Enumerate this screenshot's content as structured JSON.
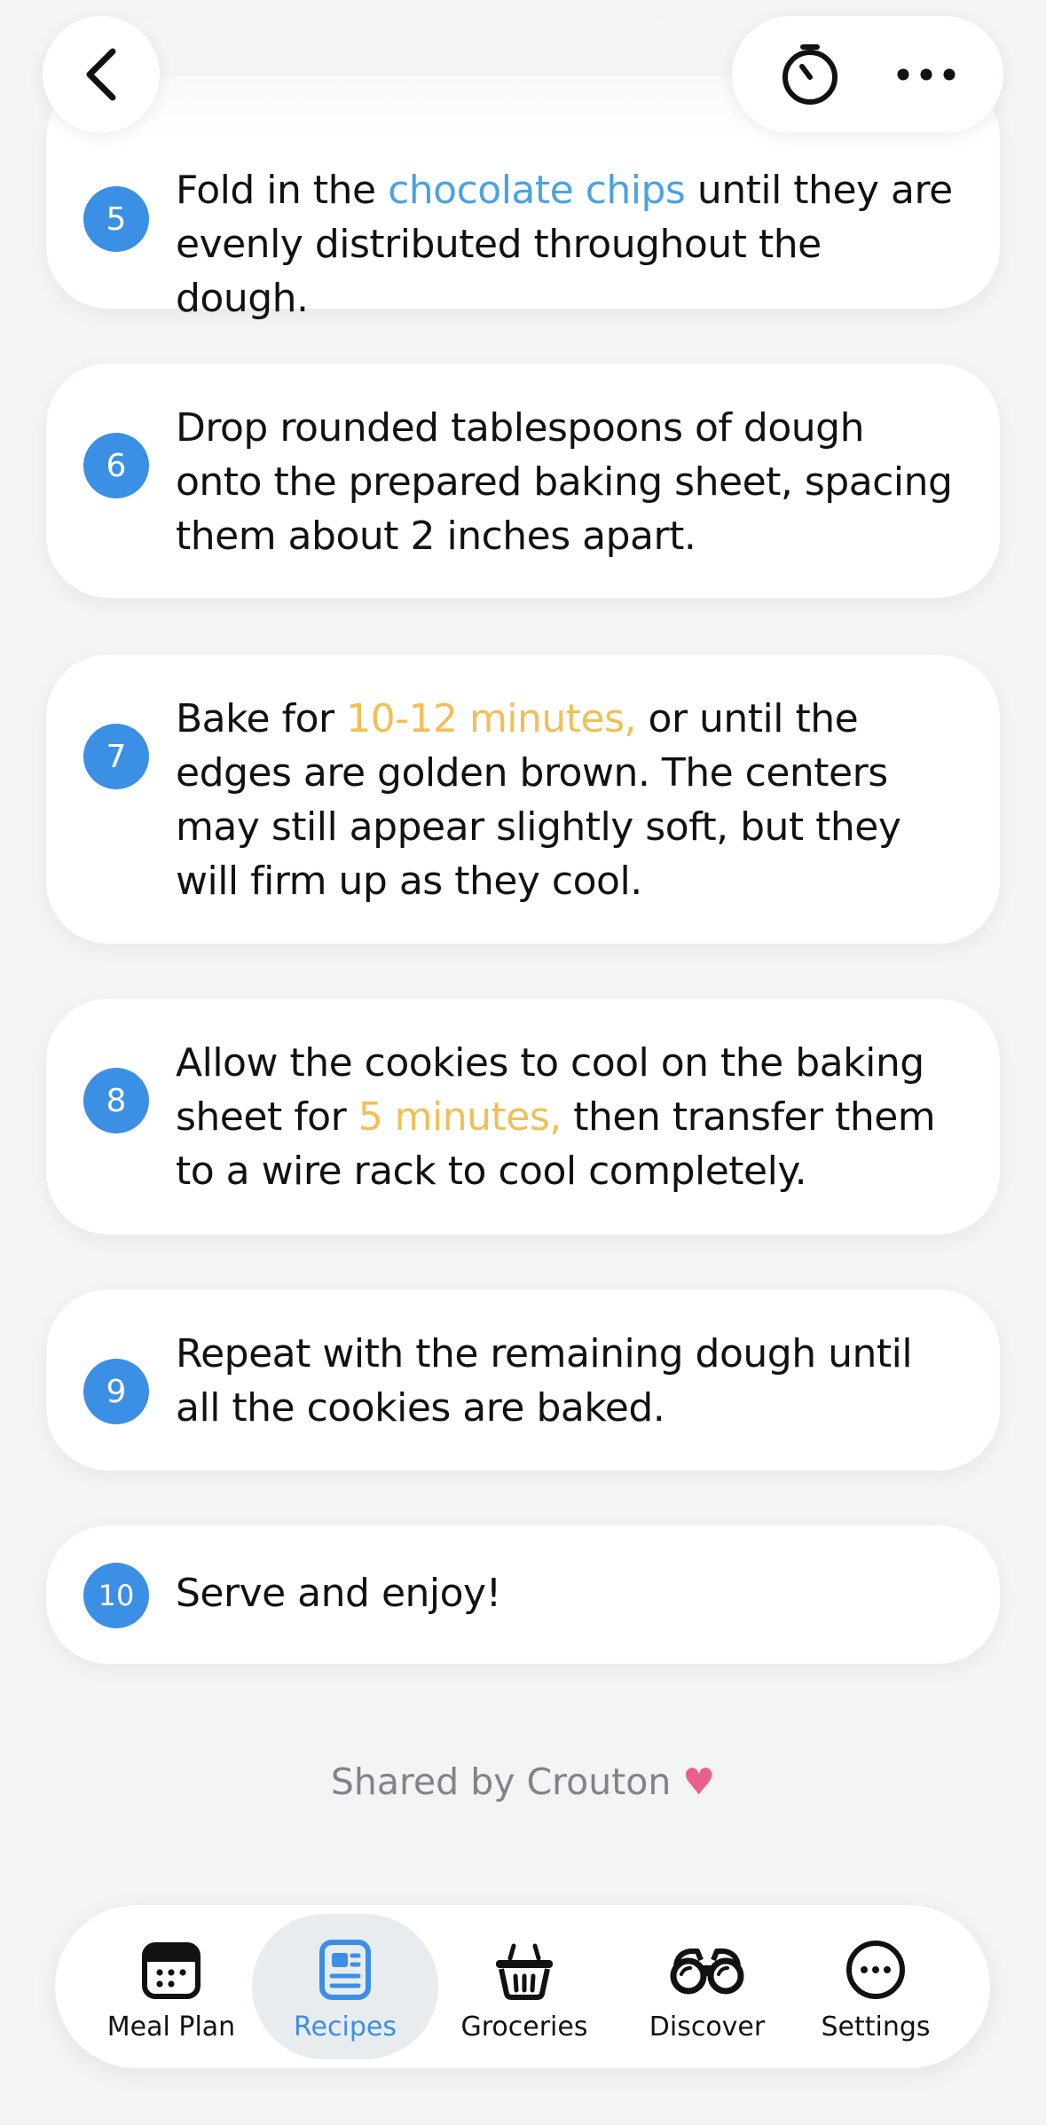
{
  "header": {
    "back_icon": "chevron-left-icon",
    "timer_icon": "timer-icon",
    "more_icon": "ellipsis-icon"
  },
  "steps": [
    {
      "number": "5",
      "parts": [
        {
          "text": "Fold in the ",
          "style": "plain"
        },
        {
          "text": "chocolate chips",
          "style": "link"
        },
        {
          "text": " until they are evenly distributed throughout the dough.",
          "style": "plain"
        }
      ]
    },
    {
      "number": "6",
      "parts": [
        {
          "text": "Drop rounded tablespoons of dough onto the prepared baking sheet, spacing them about 2 inches apart.",
          "style": "plain"
        }
      ]
    },
    {
      "number": "7",
      "parts": [
        {
          "text": "Bake for ",
          "style": "plain"
        },
        {
          "text": "10-12 minutes,",
          "style": "timer"
        },
        {
          "text": " or until the edges are golden brown. The centers may still appear slightly soft, but they will firm up as they cool.",
          "style": "plain"
        }
      ]
    },
    {
      "number": "8",
      "parts": [
        {
          "text": "Allow the cookies to cool on the baking sheet for ",
          "style": "plain"
        },
        {
          "text": "5 minutes,",
          "style": "timer"
        },
        {
          "text": " then transfer them to a wire rack to cool completely.",
          "style": "plain"
        }
      ]
    },
    {
      "number": "9",
      "parts": [
        {
          "text": "Repeat with the remaining dough until all the cookies are baked.",
          "style": "plain"
        }
      ]
    },
    {
      "number": "10",
      "parts": [
        {
          "text": "Serve and enjoy!",
          "style": "plain"
        }
      ]
    }
  ],
  "footer": {
    "shared_text": "Shared by Crouton",
    "heart": "♥"
  },
  "tabbar": {
    "tabs": [
      {
        "label": "Meal Plan",
        "icon": "calendar-icon",
        "active": false
      },
      {
        "label": "Recipes",
        "icon": "recipe-card-icon",
        "active": true
      },
      {
        "label": "Groceries",
        "icon": "basket-icon",
        "active": false
      },
      {
        "label": "Discover",
        "icon": "binoculars-icon",
        "active": false
      },
      {
        "label": "Settings",
        "icon": "ellipsis-circle-icon",
        "active": false
      }
    ]
  },
  "colors": {
    "accent": "#3b8fe4",
    "link": "#4aa3e0",
    "timer_highlight": "#f1bf55",
    "heart": "#ec5f8b",
    "background": "#f3f4f6"
  }
}
